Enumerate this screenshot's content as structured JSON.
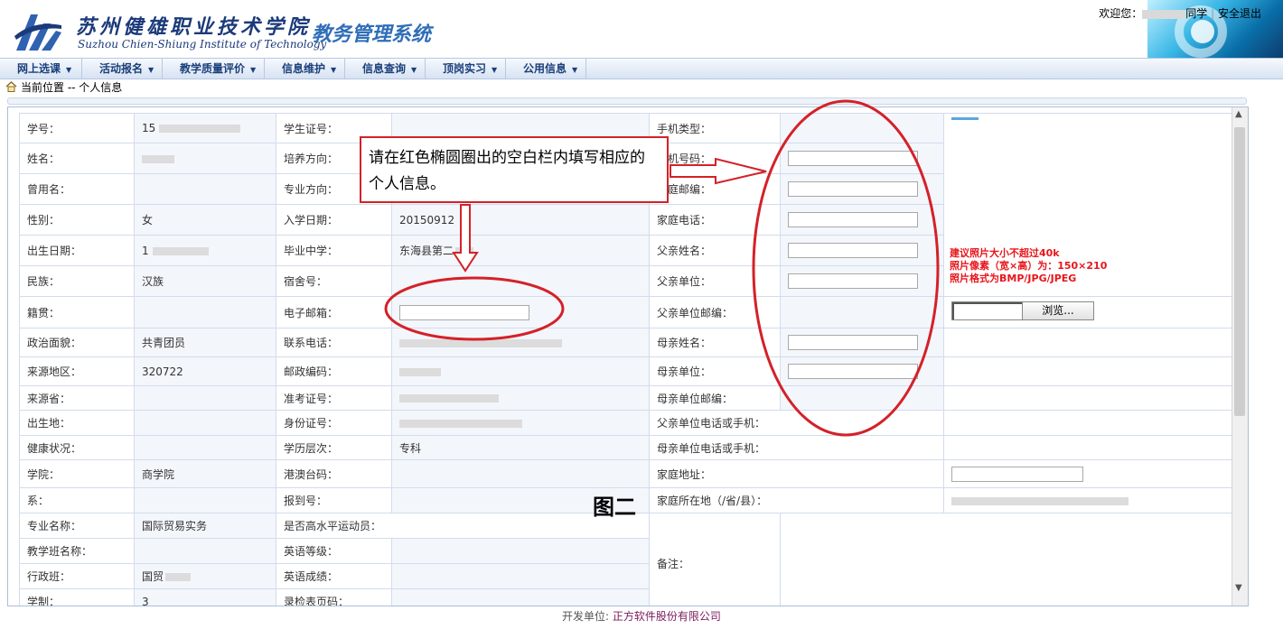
{
  "header": {
    "school_cn": "苏州健雄职业技术学院",
    "school_en": "Suzhou Chien-Shiung Institute of Technology",
    "system_title": "教务管理系统",
    "welcome_prefix": "欢迎您：",
    "welcome_suffix": "同学",
    "logout": "安全退出"
  },
  "menu": [
    {
      "label": "网上选课"
    },
    {
      "label": "活动报名"
    },
    {
      "label": "教学质量评价"
    },
    {
      "label": "信息维护"
    },
    {
      "label": "信息查询"
    },
    {
      "label": "顶岗实习"
    },
    {
      "label": "公用信息"
    }
  ],
  "breadcrumb": "当前位置 -- 个人信息",
  "annotation": {
    "text": "请在红色椭圆圈出的空白栏内填写相应的个人信息。",
    "figure_label": "图二"
  },
  "photo": {
    "note_1": "建议照片大小不超过40k",
    "note_2": "照片像素（宽×高）为：150×210",
    "note_3": "照片格式为BMP/JPG/JPEG",
    "browse_label": "浏览..."
  },
  "fields": {
    "student_id_label": "学号：",
    "student_id_value": "15",
    "name_label": "姓名：",
    "former_name_label": "曾用名：",
    "gender_label": "性别：",
    "gender_value": "女",
    "birth_label": "出生日期：",
    "birth_value": "1",
    "ethnicity_label": "民族：",
    "ethnicity_value": "汉族",
    "native_label": "籍贯：",
    "political_label": "政治面貌：",
    "political_value": "共青团员",
    "origin_label": "来源地区：",
    "origin_value": "320722",
    "origin_prov_label": "来源省：",
    "birthplace_label": "出生地：",
    "health_label": "健康状况：",
    "college_label": "学院：",
    "college_value": "商学院",
    "dept_label": "系：",
    "major_label": "专业名称：",
    "major_value": "国际贸易实务",
    "teaching_class_label": "教学班名称：",
    "admin_class_label": "行政班：",
    "admin_class_value": "国贸",
    "duration_label": "学制：",
    "duration_value": "3",
    "student_card_label": "学生证号：",
    "training_label": "培养方向：",
    "specialty_label": "专业方向：",
    "enroll_label": "入学日期：",
    "enroll_value": "20150912",
    "school_label": "毕业中学：",
    "school_value": "东海县第二",
    "dorm_label": "宿舍号：",
    "email_label": "电子邮箱：",
    "phone_label": "联系电话：",
    "postcode_label": "邮政编码：",
    "exam_label": "准考证号：",
    "idcard_label": "身份证号：",
    "edu_label": "学历层次：",
    "edu_value": "专科",
    "hkmt_label": "港澳台码：",
    "report_label": "报到号：",
    "athlete_label": "是否高水平运动员：",
    "english_level_label": "英语等级：",
    "english_score_label": "英语成绩：",
    "record_label": "录检表页码：",
    "mobile_type_label": "手机类型：",
    "mobile_label": "手机号码：",
    "home_zip_label": "家庭邮编：",
    "home_phone_label": "家庭电话：",
    "father_name_label": "父亲姓名：",
    "father_unit_label": "父亲单位：",
    "father_zip_label": "父亲单位邮编：",
    "mother_name_label": "母亲姓名：",
    "mother_unit_label": "母亲单位：",
    "mother_zip_label": "母亲单位邮编：",
    "father_tel_label": "父亲单位电话或手机：",
    "mother_tel_label": "母亲单位电话或手机：",
    "address_label": "家庭地址：",
    "home_region_label": "家庭所在地（/省/县）：",
    "remarks_label": "备注："
  },
  "footer": {
    "prefix": "开发单位:",
    "company": "正方软件股份有限公司"
  },
  "colors": {
    "annotation_red": "#d42128",
    "menu_text": "#1a3f7a",
    "title_blue": "#2f6eb8"
  }
}
